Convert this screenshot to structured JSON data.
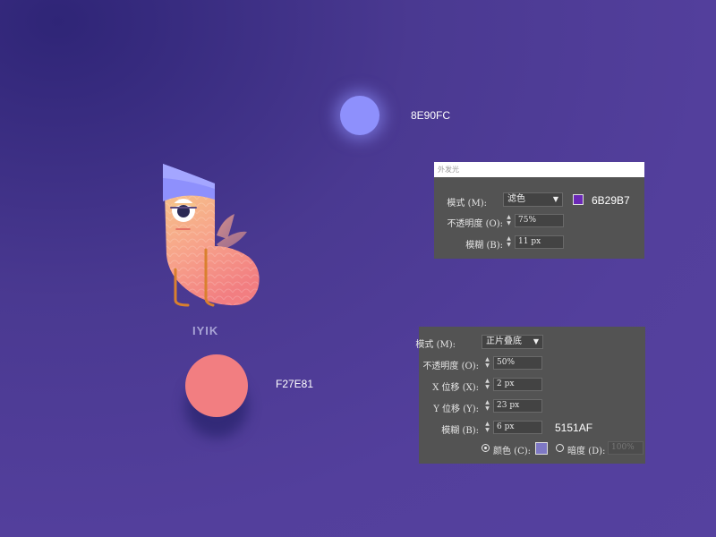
{
  "swatches": [
    {
      "hex": "8E90FC",
      "color": "#8e90fc"
    },
    {
      "hex": "F27E81",
      "color": "#f27e81"
    }
  ],
  "character": {
    "label": "IYIK"
  },
  "outer_glow_panel": {
    "title": "外发光",
    "mode_label": "模式 (M):",
    "mode_value": "滤色",
    "color_swatch": "#6b29b7",
    "color_hex": "6B29B7",
    "opacity_label": "不透明度 (O):",
    "opacity_value": "75%",
    "blur_label": "模糊 (B):",
    "blur_value": "11 px"
  },
  "drop_shadow_panel": {
    "mode_label": "模式 (M):",
    "mode_value": "正片叠底",
    "opacity_label": "不透明度 (O):",
    "opacity_value": "50%",
    "x_label": "X 位移 (X):",
    "x_value": "2 px",
    "y_label": "Y 位移 (Y):",
    "y_value": "23 px",
    "blur_label": "模糊 (B):",
    "blur_value": "6 px",
    "shadow_hex": "5151AF",
    "color_radio_label": "颜色 (C):",
    "color_radio_selected": true,
    "color_swatch": "#7e78c4",
    "darkness_radio_label": "暗度 (D):",
    "darkness_radio_selected": false,
    "darkness_value": "100%"
  }
}
